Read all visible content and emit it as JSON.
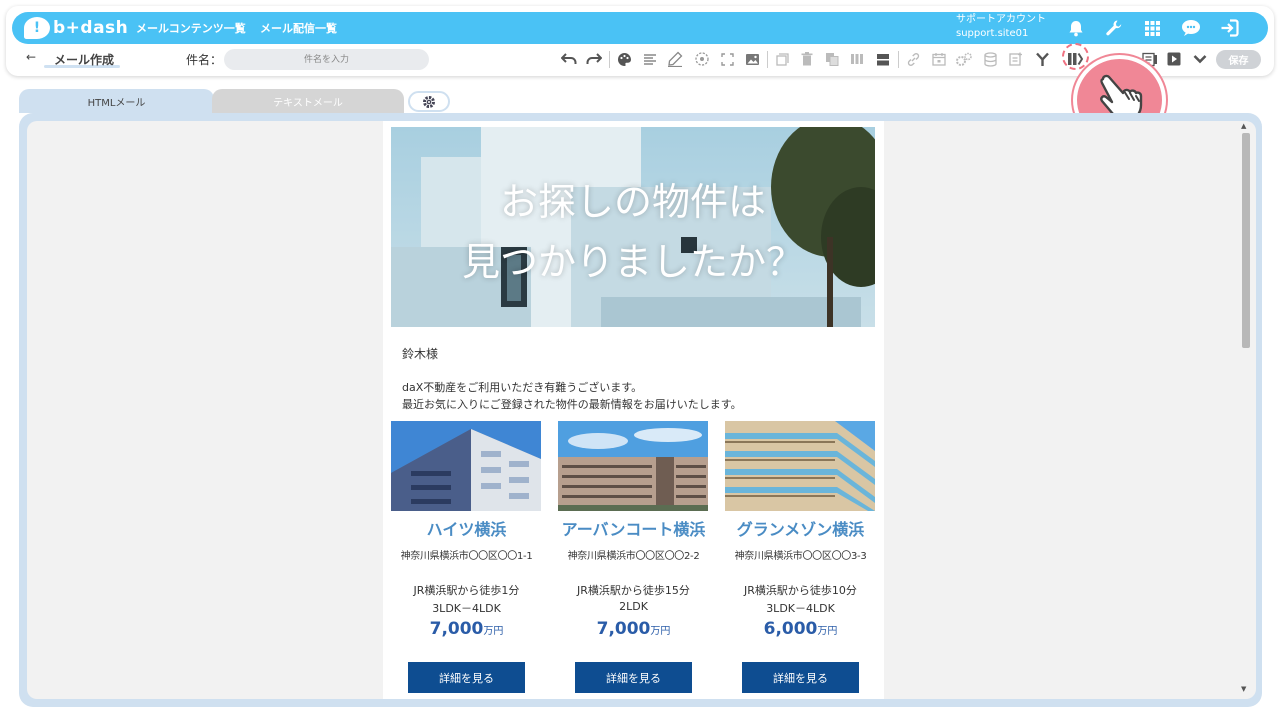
{
  "header": {
    "logo_mark": "!",
    "logo_text": "b+dash",
    "nav": [
      "メールコンテンツ一覧",
      "メール配信一覧"
    ],
    "account_name": "サポートアカウント",
    "account_id": "support.site01",
    "icons": [
      "bell-icon",
      "wrench-icon",
      "grid-icon",
      "help-icon",
      "logout-icon"
    ]
  },
  "toolbar": {
    "back_glyph": "←",
    "title": "メール作成",
    "subject_label": "件名：",
    "subject_placeholder": "件名を入力",
    "save_label": "保存"
  },
  "tabs": {
    "html": "HTMLメール",
    "text": "テキストメール"
  },
  "email": {
    "hero_line1": "お探しの物件は",
    "hero_line2": "見つかりましたか？",
    "greeting": "鈴木様",
    "intro_line1": "daX不動産をご利用いただき有難うございます。",
    "intro_line2": "最近お気に入りにご登録された物件の最新情報をお届けいたします。",
    "properties": [
      {
        "name": "ハイツ横浜",
        "address": "神奈川県横浜市〇〇区〇〇1-1",
        "access": "JR横浜駅から徒歩1分",
        "layout": "3LDK－4LDK",
        "price": "7,000",
        "unit": "万円",
        "button": "詳細を見る"
      },
      {
        "name": "アーバンコート横浜",
        "address": "神奈川県横浜市〇〇区〇〇2-2",
        "access": "JR横浜駅から徒歩15分",
        "layout": "2LDK",
        "price": "7,000",
        "unit": "万円",
        "button": "詳細を見る"
      },
      {
        "name": "グランメゾン横浜",
        "address": "神奈川県横浜市〇〇区〇〇3-3",
        "access": "JR横浜駅から徒歩10分",
        "layout": "3LDK－4LDK",
        "price": "6,000",
        "unit": "万円",
        "button": "詳細を見る"
      }
    ]
  },
  "colors": {
    "brand": "#4ac2f5",
    "panel": "#cfe0f0",
    "button": "#0e4d91",
    "property_name": "#4a8cc4",
    "price": "#2a5ca8",
    "pointer": "#f08796"
  }
}
